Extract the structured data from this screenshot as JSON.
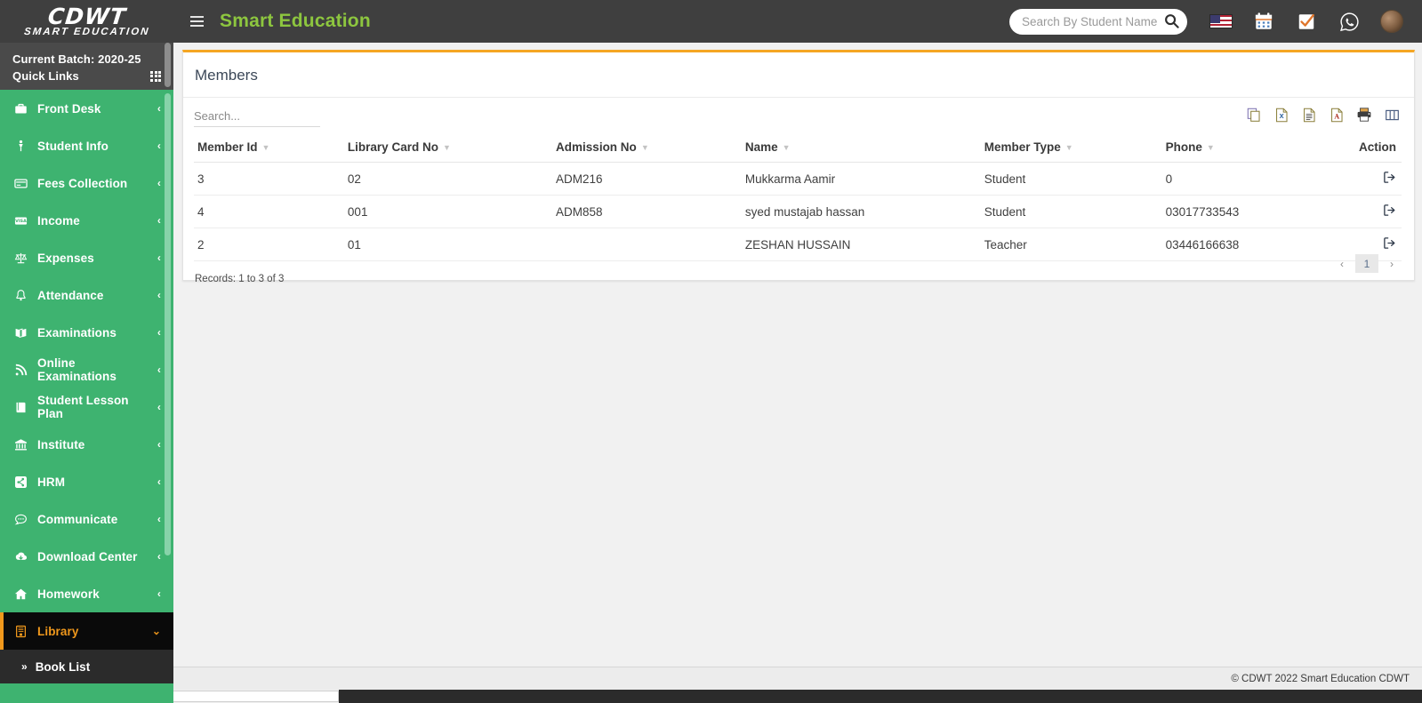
{
  "brand": {
    "name": "CDWT",
    "tagline": "SMART EDUCATION"
  },
  "topbar": {
    "app_title": "Smart Education",
    "menu_toggle": "hamburger-menu",
    "search": {
      "placeholder": "Search By Student Name",
      "value": ""
    },
    "icons": [
      {
        "name": "language-flag-us",
        "label": "English (US)"
      },
      {
        "name": "calendar-icon",
        "label": "Calendar"
      },
      {
        "name": "task-check-icon",
        "label": "Tasks"
      },
      {
        "name": "whatsapp-icon",
        "label": "WhatsApp"
      },
      {
        "name": "user-avatar",
        "label": "Profile"
      }
    ]
  },
  "sidebar": {
    "batch_label": "Current Batch: 2020-25",
    "quick_links_label": "Quick Links",
    "items": [
      {
        "label": "Front Desk",
        "icon": "briefcase-icon",
        "caret": "‹"
      },
      {
        "label": "Student Info",
        "icon": "student-icon",
        "caret": "‹"
      },
      {
        "label": "Fees Collection",
        "icon": "credit-card-icon",
        "caret": "‹"
      },
      {
        "label": "Income",
        "icon": "visa-card-icon",
        "caret": "‹"
      },
      {
        "label": "Expenses",
        "icon": "balance-scale-icon",
        "caret": "‹"
      },
      {
        "label": "Attendance",
        "icon": "bell-icon",
        "caret": "‹"
      },
      {
        "label": "Examinations",
        "icon": "book-open-icon",
        "caret": "‹"
      },
      {
        "label": "Online Examinations",
        "icon": "rss-icon",
        "caret": "‹"
      },
      {
        "label": "Student Lesson Plan",
        "icon": "book-icon",
        "caret": "‹"
      },
      {
        "label": "Institute",
        "icon": "bank-icon",
        "caret": "‹"
      },
      {
        "label": "HRM",
        "icon": "share-icon",
        "caret": "‹"
      },
      {
        "label": "Communicate",
        "icon": "comment-icon",
        "caret": "‹"
      },
      {
        "label": "Download Center",
        "icon": "cloud-download-icon",
        "caret": "‹"
      },
      {
        "label": "Homework",
        "icon": "home-icon",
        "caret": "‹"
      },
      {
        "label": "Library",
        "icon": "library-book-icon",
        "caret": "⌄",
        "active": true
      }
    ],
    "submenu": [
      {
        "label": "Book List",
        "icon": "double-chevron-right-icon"
      }
    ],
    "active_color": "#f0981c",
    "bg_color": "#3EB370"
  },
  "card": {
    "title": "Members",
    "accent_color": "#f5a623",
    "search": {
      "placeholder": "Search...",
      "value": ""
    },
    "export_buttons": [
      {
        "name": "copy-icon",
        "label": "Copy"
      },
      {
        "name": "excel-icon",
        "label": "Excel"
      },
      {
        "name": "csv-icon",
        "label": "CSV"
      },
      {
        "name": "pdf-icon",
        "label": "PDF"
      },
      {
        "name": "print-icon",
        "label": "Print"
      },
      {
        "name": "column-visibility-icon",
        "label": "Column visibility"
      }
    ]
  },
  "table": {
    "columns": [
      {
        "label": "Member Id",
        "sortable": true
      },
      {
        "label": "Library Card No",
        "sortable": true
      },
      {
        "label": "Admission No",
        "sortable": true
      },
      {
        "label": "Name",
        "sortable": true
      },
      {
        "label": "Member Type",
        "sortable": true
      },
      {
        "label": "Phone",
        "sortable": true
      },
      {
        "label": "Action",
        "sortable": false
      }
    ],
    "rows": [
      {
        "member_id": "3",
        "library_card_no": "02",
        "admission_no": "ADM216",
        "name": "Mukkarma Aamir",
        "member_type": "Student",
        "phone": "0",
        "action": "signout-arrow-icon"
      },
      {
        "member_id": "4",
        "library_card_no": "001",
        "admission_no": "ADM858",
        "name": "syed mustajab hassan",
        "member_type": "Student",
        "phone": "03017733543",
        "action": "signout-arrow-icon"
      },
      {
        "member_id": "2",
        "library_card_no": "01",
        "admission_no": "",
        "name": "ZESHAN HUSSAIN",
        "member_type": "Teacher",
        "phone": "03446166638",
        "action": "signout-arrow-icon"
      }
    ],
    "records_text": "Records: 1 to 3 of 3",
    "pagination": {
      "prev": "‹",
      "pages": [
        "1"
      ],
      "next": "›",
      "current": "1"
    }
  },
  "footer": {
    "copyright": "© CDWT 2022 Smart Education CDWT"
  }
}
